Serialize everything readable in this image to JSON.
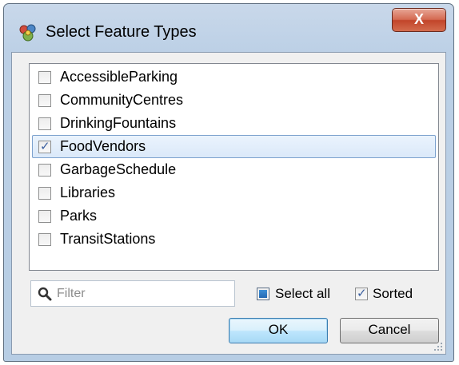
{
  "window": {
    "title": "Select Feature Types",
    "close_label": "X"
  },
  "feature_list": {
    "items": [
      {
        "label": "AccessibleParking",
        "checked": false
      },
      {
        "label": "CommunityCentres",
        "checked": false
      },
      {
        "label": "DrinkingFountains",
        "checked": false
      },
      {
        "label": "FoodVendors",
        "checked": true,
        "selected": true
      },
      {
        "label": "GarbageSchedule",
        "checked": false
      },
      {
        "label": "Libraries",
        "checked": false
      },
      {
        "label": "Parks",
        "checked": false
      },
      {
        "label": "TransitStations",
        "checked": false
      }
    ]
  },
  "filter": {
    "placeholder": "Filter",
    "value": ""
  },
  "options": {
    "select_all_label": "Select all",
    "sorted_label": "Sorted",
    "sorted_checked": true
  },
  "buttons": {
    "ok_label": "OK",
    "cancel_label": "Cancel"
  },
  "colors": {
    "selection_border": "#7da2ce",
    "check_mark": "#3a5fa0",
    "close_button": "#c2442a",
    "default_button_border": "#3c7fb1"
  },
  "icons": {
    "app": "fme-app-icon",
    "search": "search-icon",
    "close": "close-icon",
    "check": "check-icon"
  }
}
